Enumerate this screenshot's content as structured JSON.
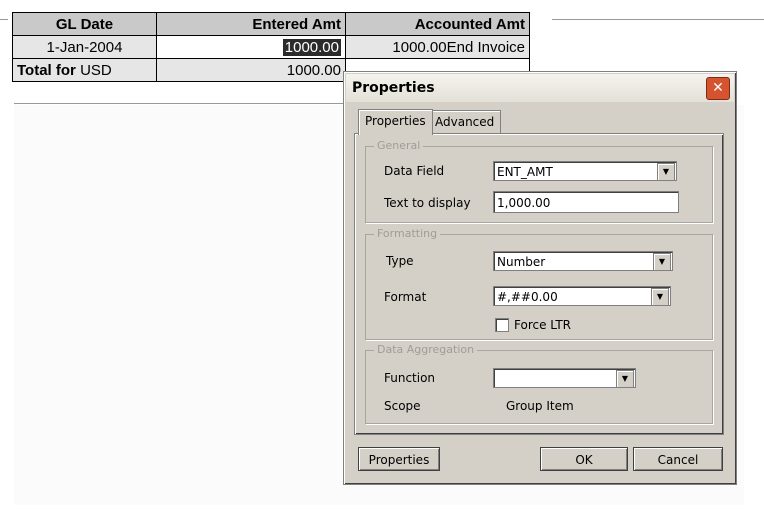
{
  "report": {
    "headers": {
      "gl_date": "GL Date",
      "entered_amt": "Entered Amt",
      "accounted_amt": "Accounted Amt"
    },
    "row": {
      "gl_date": "1-Jan-2004",
      "entered_amt": "1000.00",
      "accounted_amt": "1000.00End Invoice"
    },
    "total": {
      "label_bold": "Total for",
      "label_currency": "USD",
      "entered_amt": "1000.00"
    }
  },
  "dialog": {
    "title": "Properties",
    "tabs": [
      {
        "label": "Properties"
      },
      {
        "label": "Advanced"
      }
    ],
    "general": {
      "legend": "General",
      "data_field_label": "Data Field",
      "data_field_value": "ENT_AMT",
      "text_display_label": "Text to display",
      "text_display_value": "1,000.00"
    },
    "formatting": {
      "legend": "Formatting",
      "type_label": "Type",
      "type_value": "Number",
      "format_label": "Format",
      "format_value": "#,##0.00",
      "force_ltr_label": "Force LTR"
    },
    "aggregation": {
      "legend": "Data Aggregation",
      "function_label": "Function",
      "function_value": "",
      "scope_label": "Scope",
      "scope_value": "Group Item"
    },
    "buttons": {
      "properties": "Properties",
      "ok": "OK",
      "cancel": "Cancel"
    }
  }
}
